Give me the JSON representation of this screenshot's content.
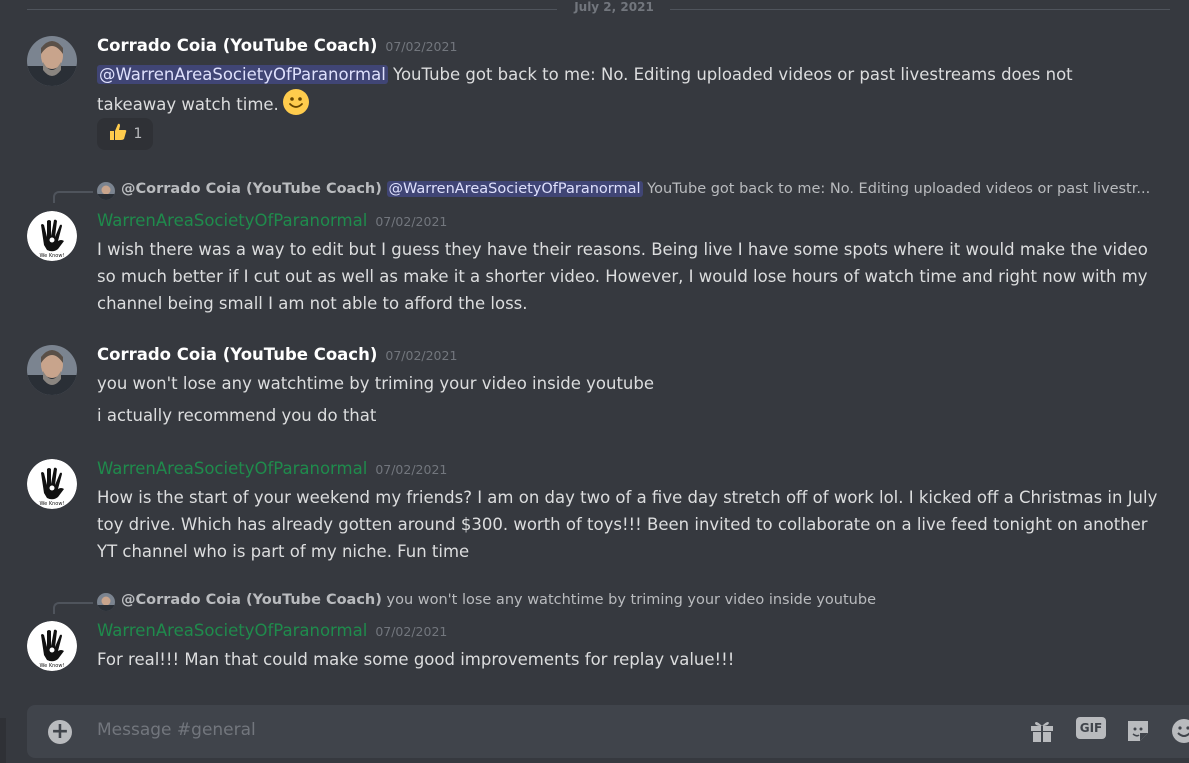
{
  "date_divider": "July 2, 2021",
  "messages": [
    {
      "author": "Corrado Coia (YouTube Coach)",
      "timestamp": "07/02/2021",
      "mention": "@WarrenAreaSocietyOfParanormal",
      "text_line1": " YouTube got back to me: No. Editing uploaded videos or past livestreams does not",
      "text_line2": "takeaway watch time.",
      "emoji": "slightly-smiling-face",
      "reaction": {
        "emoji": "thumbs-up",
        "count": "1"
      }
    },
    {
      "reply": {
        "name": "@Corrado Coia (YouTube Coach)",
        "mention": "@WarrenAreaSocietyOfParanormal",
        "text": " YouTube got back to me: No. Editing uploaded videos or past livestr..."
      },
      "author": "WarrenAreaSocietyOfParanormal",
      "timestamp": "07/02/2021",
      "text": "I wish there was a way to edit but I guess they have their reasons. Being live I have some spots where it would make the video so much better if I cut out as well as make it a shorter video. However, I would lose hours of watch time and right now with my channel being small I am not able to afford the loss."
    },
    {
      "author": "Corrado Coia (YouTube Coach)",
      "timestamp": "07/02/2021",
      "text": "you won't lose any watchtime by triming your video inside youtube",
      "text2": "i actually recommend you do that"
    },
    {
      "author": "WarrenAreaSocietyOfParanormal",
      "timestamp": "07/02/2021",
      "text": "How is the start of your weekend my friends? I am on day two of a five day stretch off of work lol. I kicked off a Christmas in July toy drive. Which has already gotten around $300. worth of toys!!! Been invited to collaborate on a live feed tonight on another YT channel who is part of my niche. Fun time"
    },
    {
      "reply": {
        "name": "@Corrado Coia (YouTube Coach)",
        "text": " you won't lose any watchtime by triming your video inside youtube"
      },
      "author": "WarrenAreaSocietyOfParanormal",
      "timestamp": "07/02/2021",
      "text": "For real!!! Man that could make some good improvements for replay value!!!"
    }
  ],
  "composer": {
    "placeholder": "Message #general",
    "gif_label": "GIF",
    "icons": [
      "plus-icon",
      "gift-icon",
      "gif-icon",
      "sticker-icon",
      "emoji-icon"
    ]
  },
  "colors": {
    "background": "#36393f",
    "username_green": "#1f8b4c",
    "mention_bg": "#4b5289"
  },
  "avatar_badge_text": "We Know!"
}
